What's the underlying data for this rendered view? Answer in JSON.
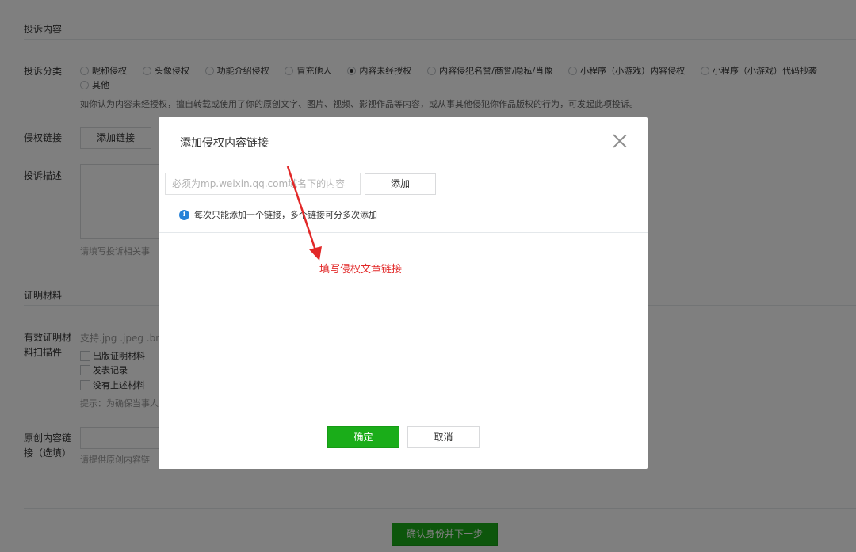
{
  "form": {
    "section_complaint": "投诉内容",
    "category_label": "投诉分类",
    "categories": [
      {
        "label": "昵称侵权",
        "checked": false
      },
      {
        "label": "头像侵权",
        "checked": false
      },
      {
        "label": "功能介绍侵权",
        "checked": false
      },
      {
        "label": "冒充他人",
        "checked": false
      },
      {
        "label": "内容未经授权",
        "checked": true
      },
      {
        "label": "内容侵犯名誉/商誉/隐私/肖像",
        "checked": false
      },
      {
        "label": "小程序（小游戏）内容侵权",
        "checked": false
      },
      {
        "label": "小程序（小游戏）代码抄袭",
        "checked": false
      },
      {
        "label": "其他",
        "checked": false
      }
    ],
    "category_hint": "如你认为内容未经授权，擅自转载或使用了你的原创文字、图片、视频、影视作品等内容，或从事其他侵犯你作品版权的行为，可发起此项投诉。",
    "link_label": "侵权链接",
    "add_link_button": "添加链接",
    "desc_label": "投诉描述",
    "desc_hint": "请填写投诉相关事",
    "section_evidence": "证明材料",
    "evidence_label_1": "有效证明材",
    "evidence_label_2": "料扫描件",
    "evidence_support": "支持.jpg .jpeg .bm",
    "evidence_options": [
      "出版证明材料",
      "发表记录",
      "没有上述材料"
    ],
    "evidence_tip": "提示：为确保当事人",
    "original_label_1": "原创内容链",
    "original_label_2": "接（选填）",
    "original_hint": "请提供原创内容链",
    "next_button": "确认身份并下一步"
  },
  "dialog": {
    "title": "添加侵权内容链接",
    "input_placeholder": "必须为mp.weixin.qq.com域名下的内容",
    "add_button": "添加",
    "info_text": "每次只能添加一个链接，多个链接可分多次添加",
    "annotation": "填写侵权文章链接",
    "ok_button": "确定",
    "cancel_button": "取消"
  },
  "colors": {
    "primary_green": "#1aad19",
    "info_blue": "#2782d7",
    "annotation_red": "#e22828"
  }
}
